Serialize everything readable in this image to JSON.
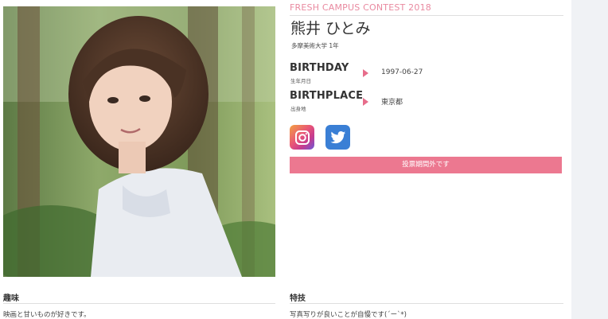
{
  "profile": {
    "contest": "FRESH CAMPUS CONTEST 2018",
    "name": "熊井 ひとみ",
    "school": "多摩美術大学 1年",
    "birthday": {
      "label": "BIRTHDAY",
      "sub": "生年月日",
      "value": "1997-06-27"
    },
    "birthplace": {
      "label": "BIRTHPLACE",
      "sub": "出身地",
      "value": "東京都"
    },
    "sns": [
      {
        "icon": "instagram-icon",
        "color": "#e85577"
      },
      {
        "icon": "twitter-icon",
        "color": "#3a7fd5"
      }
    ],
    "vote_label": "投票期間外です"
  },
  "sections": {
    "hobby": {
      "title": "趣味",
      "text": "映画と甘いものが好きです。"
    },
    "skill": {
      "title": "特技",
      "text": "写真写りが良いことが自慢です(´ー`*)"
    }
  },
  "colors": {
    "accent": "#ec7890",
    "contest_text": "#e98aa0"
  }
}
